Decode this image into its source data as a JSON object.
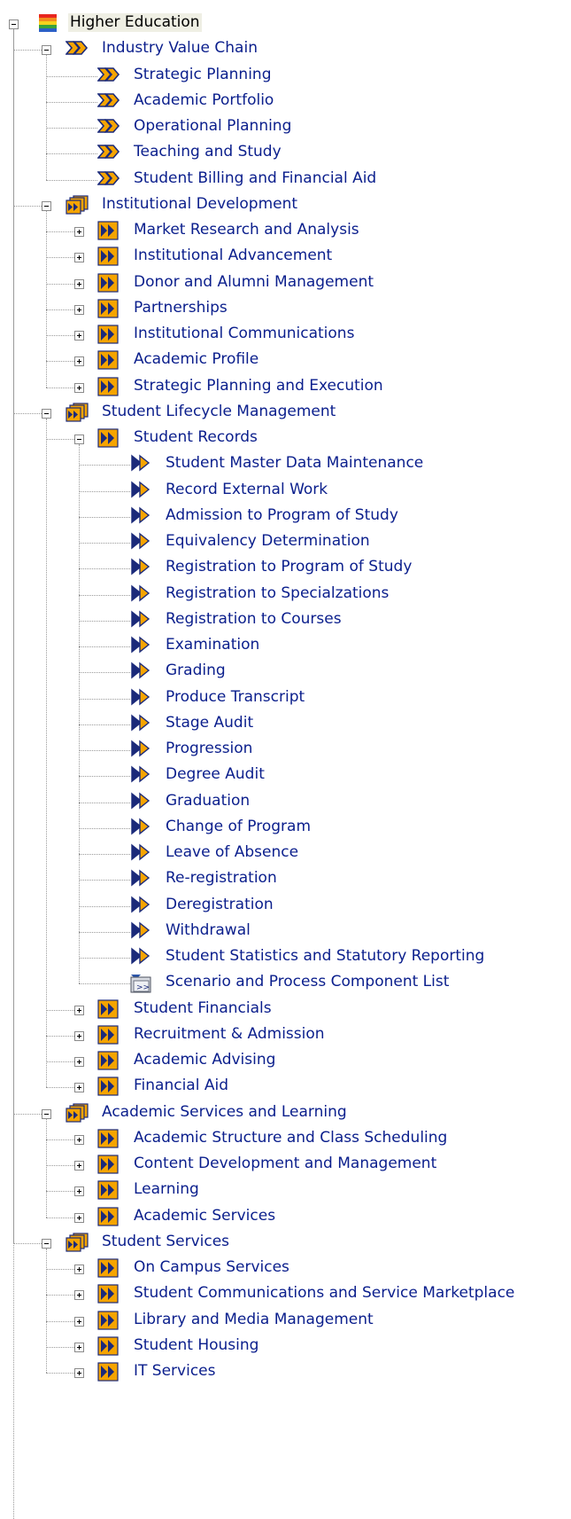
{
  "tree": {
    "root": {
      "label": "Higher Education",
      "icon": "color-stack-icon",
      "expanded": true
    },
    "nodes": [
      {
        "label": "Industry Value Chain",
        "level": 1,
        "icon": "value-chain-icon",
        "toggle": "minus"
      },
      {
        "label": "Strategic Planning",
        "level": 2,
        "icon": "value-chain-icon"
      },
      {
        "label": "Academic Portfolio",
        "level": 2,
        "icon": "value-chain-icon"
      },
      {
        "label": "Operational Planning",
        "level": 2,
        "icon": "value-chain-icon"
      },
      {
        "label": "Teaching and Study",
        "level": 2,
        "icon": "value-chain-icon"
      },
      {
        "label": "Student Billing and Financial Aid",
        "level": 2,
        "icon": "value-chain-icon"
      },
      {
        "label": "Institutional Development",
        "level": 1,
        "icon": "process-folder-icon",
        "toggle": "minus"
      },
      {
        "label": "Market Research and Analysis",
        "level": 2,
        "icon": "process-icon",
        "toggle": "plus"
      },
      {
        "label": "Institutional Advancement",
        "level": 2,
        "icon": "process-icon",
        "toggle": "plus"
      },
      {
        "label": "Donor and Alumni Management",
        "level": 2,
        "icon": "process-icon",
        "toggle": "plus"
      },
      {
        "label": "Partnerships",
        "level": 2,
        "icon": "process-icon",
        "toggle": "plus"
      },
      {
        "label": "Institutional Communications",
        "level": 2,
        "icon": "process-icon",
        "toggle": "plus"
      },
      {
        "label": "Academic Profile",
        "level": 2,
        "icon": "process-icon",
        "toggle": "plus"
      },
      {
        "label": "Strategic Planning and Execution",
        "level": 2,
        "icon": "process-icon",
        "toggle": "plus"
      },
      {
        "label": "Student Lifecycle Management",
        "level": 1,
        "icon": "process-folder-icon",
        "toggle": "minus"
      },
      {
        "label": "Student Records",
        "level": 2,
        "icon": "process-icon",
        "toggle": "minus"
      },
      {
        "label": "Student Master Data Maintenance",
        "level": 3,
        "icon": "process-step-icon"
      },
      {
        "label": "Record External Work",
        "level": 3,
        "icon": "process-step-icon"
      },
      {
        "label": "Admission to Program of Study",
        "level": 3,
        "icon": "process-step-icon"
      },
      {
        "label": "Equivalency Determination",
        "level": 3,
        "icon": "process-step-icon"
      },
      {
        "label": "Registration to Program of Study",
        "level": 3,
        "icon": "process-step-icon"
      },
      {
        "label": "Registration to Specialzations",
        "level": 3,
        "icon": "process-step-icon"
      },
      {
        "label": "Registration to Courses",
        "level": 3,
        "icon": "process-step-icon"
      },
      {
        "label": "Examination",
        "level": 3,
        "icon": "process-step-icon"
      },
      {
        "label": "Grading",
        "level": 3,
        "icon": "process-step-icon"
      },
      {
        "label": "Produce Transcript",
        "level": 3,
        "icon": "process-step-icon"
      },
      {
        "label": "Stage Audit",
        "level": 3,
        "icon": "process-step-icon"
      },
      {
        "label": "Progression",
        "level": 3,
        "icon": "process-step-icon"
      },
      {
        "label": "Degree Audit",
        "level": 3,
        "icon": "process-step-icon"
      },
      {
        "label": "Graduation",
        "level": 3,
        "icon": "process-step-icon"
      },
      {
        "label": "Change of Program",
        "level": 3,
        "icon": "process-step-icon"
      },
      {
        "label": "Leave of Absence",
        "level": 3,
        "icon": "process-step-icon"
      },
      {
        "label": "Re-registration",
        "level": 3,
        "icon": "process-step-icon"
      },
      {
        "label": "Deregistration",
        "level": 3,
        "icon": "process-step-icon"
      },
      {
        "label": "Withdrawal",
        "level": 3,
        "icon": "process-step-icon"
      },
      {
        "label": "Student Statistics and Statutory Reporting",
        "level": 3,
        "icon": "process-step-icon"
      },
      {
        "label": "Scenario and Process Component List",
        "level": 3,
        "icon": "component-list-icon"
      },
      {
        "label": "Student Financials",
        "level": 2,
        "icon": "process-icon",
        "toggle": "plus"
      },
      {
        "label": "Recruitment & Admission",
        "level": 2,
        "icon": "process-icon",
        "toggle": "plus"
      },
      {
        "label": "Academic Advising",
        "level": 2,
        "icon": "process-icon",
        "toggle": "plus"
      },
      {
        "label": "Financial Aid",
        "level": 2,
        "icon": "process-icon",
        "toggle": "plus"
      },
      {
        "label": "Academic Services and Learning",
        "level": 1,
        "icon": "process-folder-icon",
        "toggle": "minus"
      },
      {
        "label": "Academic Structure and Class Scheduling",
        "level": 2,
        "icon": "process-icon",
        "toggle": "plus"
      },
      {
        "label": "Content Development and Management",
        "level": 2,
        "icon": "process-icon",
        "toggle": "plus"
      },
      {
        "label": "Learning",
        "level": 2,
        "icon": "process-icon",
        "toggle": "plus"
      },
      {
        "label": "Academic Services",
        "level": 2,
        "icon": "process-icon",
        "toggle": "plus"
      },
      {
        "label": "Student Services",
        "level": 1,
        "icon": "process-folder-icon",
        "toggle": "minus"
      },
      {
        "label": "On Campus Services",
        "level": 2,
        "icon": "process-icon",
        "toggle": "plus"
      },
      {
        "label": "Student Communications and Service Marketplace",
        "level": 2,
        "icon": "process-icon",
        "toggle": "plus"
      },
      {
        "label": "Library and Media Management",
        "level": 2,
        "icon": "process-icon",
        "toggle": "plus"
      },
      {
        "label": "Student Housing",
        "level": 2,
        "icon": "process-icon",
        "toggle": "plus"
      },
      {
        "label": "IT Services",
        "level": 2,
        "icon": "process-icon",
        "toggle": "plus"
      }
    ]
  },
  "colors": {
    "label": "#0a1e8c",
    "root_label": "#000000",
    "root_bg": "#efefe4",
    "icon_orange": "#f5a400",
    "icon_navy": "#1b2a7a"
  }
}
